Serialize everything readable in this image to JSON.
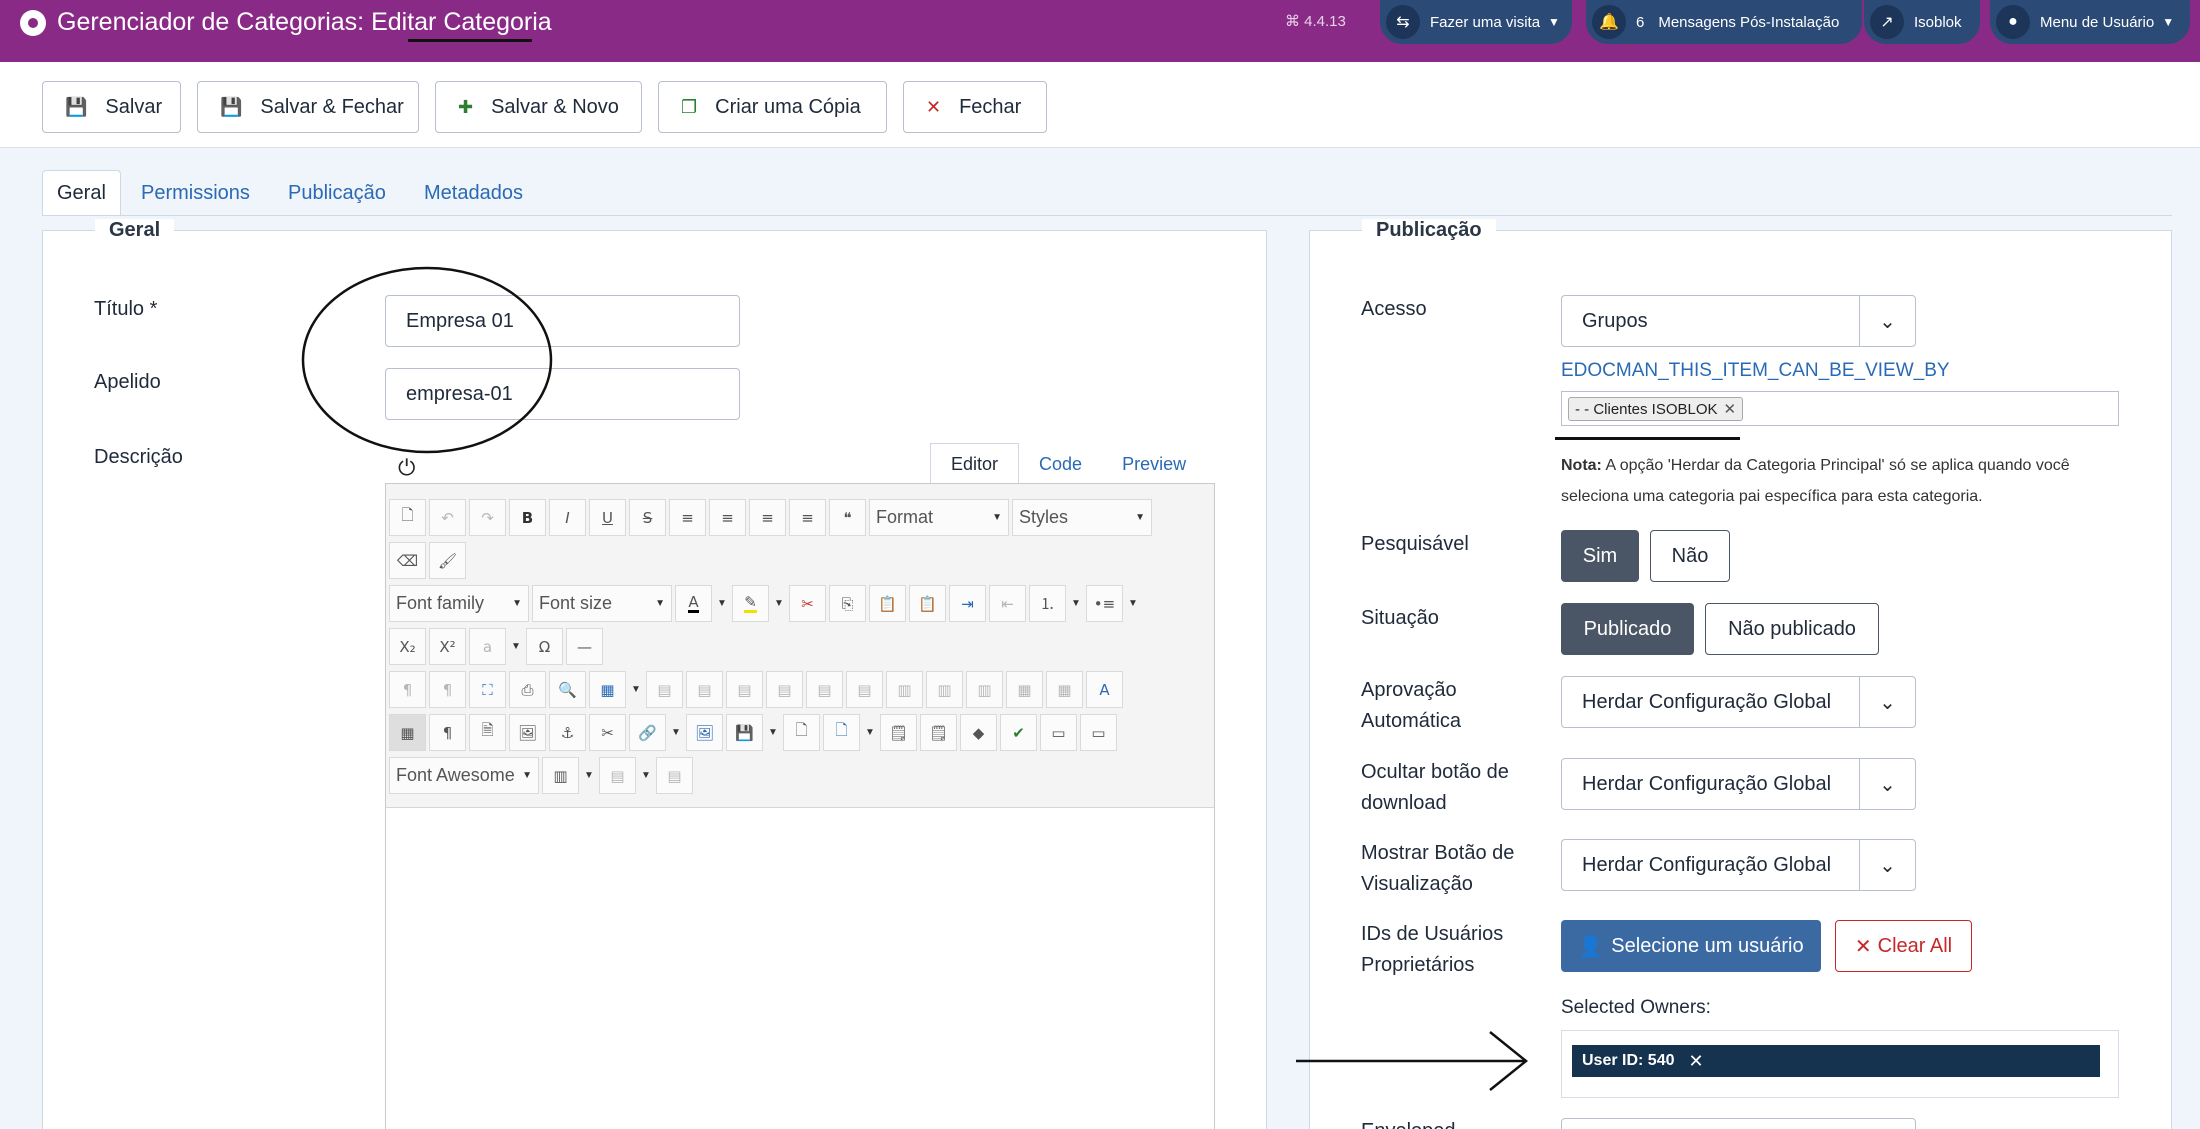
{
  "header": {
    "title": "Gerenciador de Categorias: Editar Categoria",
    "version": "⌘ 4.4.13",
    "visit_label": "Fazer uma visita",
    "notif_count": "6",
    "notif_label": "Mensagens Pós-Instalação",
    "site_label": "Isoblok",
    "user_menu_label": "Menu de Usuário"
  },
  "toolbar": {
    "save": "Salvar",
    "save_close": "Salvar & Fechar",
    "save_new": "Salvar & Novo",
    "save_copy": "Criar uma Cópia",
    "close": "Fechar"
  },
  "tabs": [
    "Geral",
    "Permissions",
    "Publicação",
    "Metadados"
  ],
  "left": {
    "legend": "Geral",
    "title_label": "Título *",
    "title_value": "Empresa 01",
    "alias_label": "Apelido",
    "alias_value": "empresa-01",
    "description_label": "Descrição",
    "editor_tabs": [
      "Editor",
      "Code",
      "Preview"
    ],
    "editor_selects": {
      "format": "Format",
      "styles": "Styles",
      "font_family": "Font family",
      "font_size": "Font size",
      "font_awesome": "Font Awesome"
    }
  },
  "right": {
    "legend": "Publicação",
    "access_label": "Acesso",
    "access_value": "Grupos",
    "view_by_label": "EDOCMAN_THIS_ITEM_CAN_BE_VIEW_BY",
    "view_by_chip": "- - Clientes ISOBLOK",
    "note_strong": "Nota:",
    "note_text": " A opção 'Herdar da Categoria Principal' só se aplica quando você seleciona uma categoria pai específica para esta categoria.",
    "searchable_label": "Pesquisável",
    "searchable_yes": "Sim",
    "searchable_no": "Não",
    "status_label": "Situação",
    "status_published": "Publicado",
    "status_unpublished": "Não publicado",
    "auto_approve_label": "Aprovação Automática",
    "auto_approve_value": "Herdar Configuração Global",
    "hide_download_label": "Ocultar botão de download",
    "hide_download_value": "Herdar Configuração Global",
    "show_view_label": "Mostrar Botão de Visualização",
    "show_view_value": "Herdar Configuração Global",
    "owner_ids_label": "IDs de Usuários Proprietários",
    "select_user_button": "Selecione um usuário",
    "clear_all_button": "Clear All",
    "selected_owners_label": "Selected Owners:",
    "owner_chip": "User ID: 540",
    "next_label": "Enveloped"
  },
  "colors": {
    "header_bg": "#8a2a87",
    "header_btn": "#2b4a75",
    "primary": "#3b6aa3",
    "danger": "#c62828",
    "toggle_on": "#4a5565"
  }
}
